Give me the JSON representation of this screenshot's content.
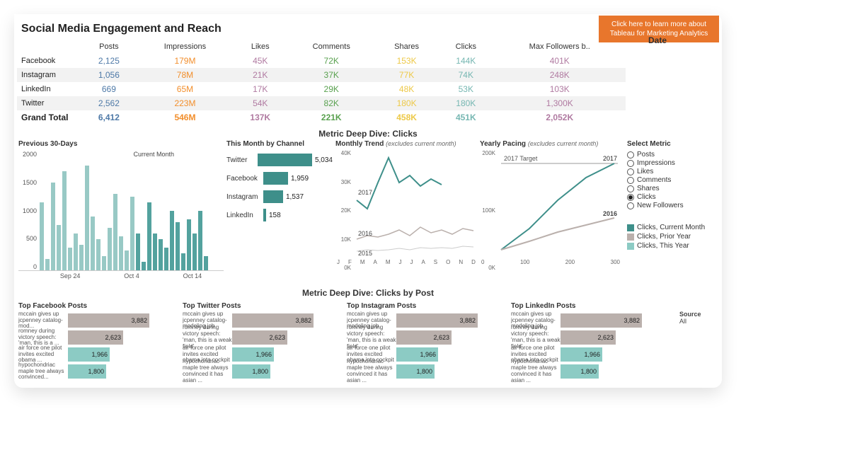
{
  "title": "Social Media Engagement and Reach",
  "banner": "Click here to learn more about Tableau for Marketing Analytics",
  "date_label": "Date",
  "table": {
    "headers": [
      "",
      "Posts",
      "Impressions",
      "Likes",
      "Comments",
      "Shares",
      "Clicks",
      "Max Followers b.."
    ],
    "rows": [
      {
        "name": "Facebook",
        "posts": "2,125",
        "impr": "179M",
        "likes": "45K",
        "comm": "72K",
        "shares": "153K",
        "clicks": "144K",
        "foll": "401K"
      },
      {
        "name": "Instagram",
        "posts": "1,056",
        "impr": "78M",
        "likes": "21K",
        "comm": "37K",
        "shares": "77K",
        "clicks": "74K",
        "foll": "248K"
      },
      {
        "name": "LinkedIn",
        "posts": "669",
        "impr": "65M",
        "likes": "17K",
        "comm": "29K",
        "shares": "48K",
        "clicks": "53K",
        "foll": "103K"
      },
      {
        "name": "Twitter",
        "posts": "2,562",
        "impr": "223M",
        "likes": "54K",
        "comm": "82K",
        "shares": "180K",
        "clicks": "180K",
        "foll": "1,300K"
      }
    ],
    "total": {
      "name": "Grand Total",
      "posts": "6,412",
      "impr": "546M",
      "likes": "137K",
      "comm": "221K",
      "shares": "458K",
      "clicks": "451K",
      "foll": "2,052K"
    }
  },
  "deepdive_title": "Metric Deep Dive: Clicks",
  "prev30": {
    "title": "Previous 30-Days",
    "annot": "Current Month",
    "yticks": [
      "2000",
      "1500",
      "1000",
      "500",
      "0"
    ],
    "xticks": [
      "Sep 24",
      "Oct 4",
      "Oct 14"
    ],
    "bars": [
      1200,
      200,
      1550,
      800,
      1750,
      400,
      650,
      450,
      1850,
      950,
      550,
      250,
      750,
      1350,
      600,
      350,
      1300,
      650,
      150,
      1200,
      650,
      550,
      400,
      1050,
      850,
      300,
      900,
      650,
      1050,
      250
    ]
  },
  "bychan": {
    "title": "This Month by Channel",
    "rows": [
      {
        "name": "Twitter",
        "val": "5,034",
        "w": 90
      },
      {
        "name": "Facebook",
        "val": "1,959",
        "w": 35
      },
      {
        "name": "Instagram",
        "val": "1,537",
        "w": 28
      },
      {
        "name": "LinkedIn",
        "val": "158",
        "w": 4
      }
    ]
  },
  "trend": {
    "title": "Monthly Trend",
    "sub": "(excludes current month)",
    "yticks": [
      "40K",
      "30K",
      "20K",
      "10K",
      "0K"
    ],
    "xticks": [
      "J",
      "F",
      "M",
      "A",
      "M",
      "J",
      "J",
      "A",
      "S",
      "O",
      "N",
      "D"
    ],
    "labels": {
      "a": "2017",
      "b": "2016",
      "c": "2015"
    }
  },
  "pacing": {
    "title": "Yearly Pacing",
    "sub": "(excludes current month)",
    "target": "2017 Target",
    "yr": "2017",
    "yr2": "2016",
    "yticks": [
      "200K",
      "100K",
      "0K"
    ],
    "xticks": [
      "0",
      "100",
      "200",
      "300"
    ]
  },
  "selector": {
    "title": "Select Metric",
    "options": [
      "Posts",
      "Impressions",
      "Likes",
      "Comments",
      "Shares",
      "Clicks",
      "New Followers"
    ],
    "selected": "Clicks"
  },
  "legend": [
    {
      "color": "#3E8F8A",
      "label": "Clicks, Current Month"
    },
    {
      "color": "#BAB0AC",
      "label": "Clicks, Prior Year"
    },
    {
      "color": "#8CCBC4",
      "label": "Clicks, This Year"
    }
  ],
  "posts_title": "Metric Deep Dive: Clicks by Post",
  "posts_cols": [
    {
      "title": "Top Facebook Posts"
    },
    {
      "title": "Top Twitter Posts"
    },
    {
      "title": "Top Instagram Posts"
    },
    {
      "title": "Top LinkedIn Posts"
    }
  ],
  "post_labels": [
    "mccain gives up jcpenney catalog-mod...",
    "romney during victory speech: 'man, this is a ...",
    "air force one pilot invites excited obama ...",
    "hypochondriac maple tree always convinced..."
  ],
  "post_labels_full": [
    "mccain gives up jcpenney catalog-modeling job",
    "romney during victory speech: 'man, this is a weak field'",
    "air force one pilot invites excited obama into cockpit",
    "hypochondriac maple tree always convinced it has asian ..."
  ],
  "post_rows": [
    {
      "val": "3,882",
      "w": 115,
      "cls": "gray"
    },
    {
      "val": "2,623",
      "w": 78,
      "cls": "gray"
    },
    {
      "val": "1,966",
      "w": 59,
      "cls": "teal"
    },
    {
      "val": "1,800",
      "w": 54,
      "cls": "teal"
    }
  ],
  "source": {
    "title": "Source",
    "val": "All"
  },
  "chart_data": {
    "type": "table+bar+line",
    "summary_table": [
      {
        "channel": "Facebook",
        "Posts": 2125,
        "Impressions": 179000000,
        "Likes": 45000,
        "Comments": 72000,
        "Shares": 153000,
        "Clicks": 144000,
        "MaxFollowers": 401000
      },
      {
        "channel": "Instagram",
        "Posts": 1056,
        "Impressions": 78000000,
        "Likes": 21000,
        "Comments": 37000,
        "Shares": 77000,
        "Clicks": 74000,
        "MaxFollowers": 248000
      },
      {
        "channel": "LinkedIn",
        "Posts": 669,
        "Impressions": 65000000,
        "Likes": 17000,
        "Comments": 29000,
        "Shares": 48000,
        "Clicks": 53000,
        "MaxFollowers": 103000
      },
      {
        "channel": "Twitter",
        "Posts": 2562,
        "Impressions": 223000000,
        "Likes": 54000,
        "Comments": 82000,
        "Shares": 180000,
        "Clicks": 180000,
        "MaxFollowers": 1300000
      }
    ],
    "previous_30_days_clicks": [
      1200,
      200,
      1550,
      800,
      1750,
      400,
      650,
      450,
      1850,
      950,
      550,
      250,
      750,
      1350,
      600,
      350,
      1300,
      650,
      150,
      1200,
      650,
      550,
      400,
      1050,
      850,
      300,
      900,
      650,
      1050,
      250
    ],
    "this_month_by_channel": {
      "Twitter": 5034,
      "Facebook": 1959,
      "Instagram": 1537,
      "LinkedIn": 158
    },
    "monthly_trend": {
      "x": [
        "J",
        "F",
        "M",
        "A",
        "M",
        "J",
        "J",
        "A",
        "S",
        "O",
        "N",
        "D"
      ],
      "series": [
        {
          "name": "2017",
          "values": [
            22000,
            18000,
            28000,
            40000,
            30000,
            33000,
            28000,
            32000,
            29000,
            null,
            null,
            null
          ]
        },
        {
          "name": "2016",
          "values": [
            5000,
            7000,
            6000,
            8000,
            10000,
            7000,
            11000,
            8000,
            9000,
            7000,
            10000,
            9000
          ]
        },
        {
          "name": "2015",
          "values": [
            1000,
            2000,
            1500,
            2000,
            2500,
            2000,
            3000,
            2500,
            3000,
            2500,
            3500,
            3000
          ]
        }
      ],
      "ylim": [
        0,
        40000
      ]
    },
    "yearly_pacing": {
      "x": [
        0,
        100,
        200,
        300
      ],
      "target_2017": 250000,
      "series": [
        {
          "name": "2017",
          "values": [
            0,
            100000,
            180000,
            250000
          ]
        },
        {
          "name": "2016",
          "values": [
            0,
            35000,
            70000,
            95000
          ]
        }
      ],
      "ylim": [
        0,
        250000
      ]
    },
    "top_posts_clicks": [
      3882,
      2623,
      1966,
      1800
    ]
  }
}
